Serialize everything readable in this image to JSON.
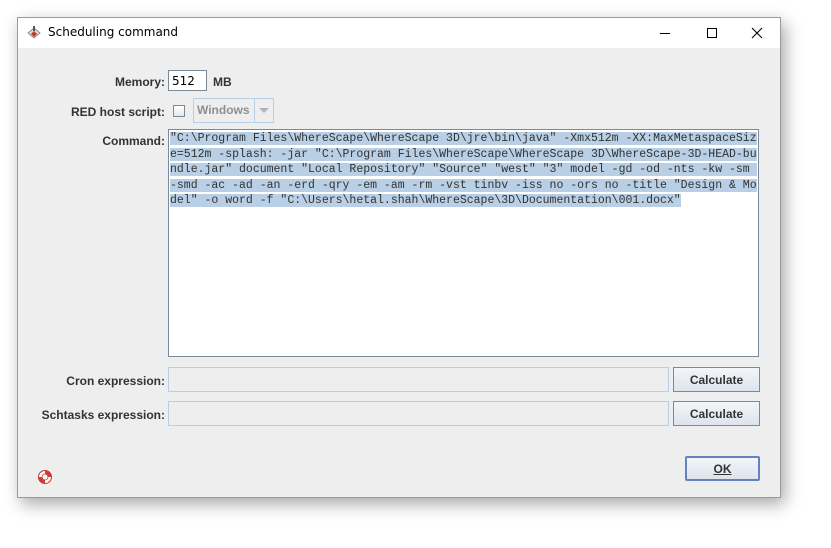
{
  "window": {
    "title": "Scheduling command"
  },
  "memory": {
    "label": "Memory:",
    "value": "512",
    "unit": "MB"
  },
  "red_host_script": {
    "label": "RED host script:",
    "checked": false,
    "os_value": "Windows"
  },
  "command": {
    "label": "Command:",
    "value": "\"C:\\Program Files\\WhereScape\\WhereScape 3D\\jre\\bin\\java\" -Xmx512m -XX:MaxMetaspaceSize=512m -splash: -jar \"C:\\Program Files\\WhereScape\\WhereScape 3D\\WhereScape-3D-HEAD-bundle.jar\" document \"Local Repository\" \"Source\" \"west\" \"3\" model -gd -od -nts -kw -sm -smd -ac -ad -an -erd -qry -em -am -rm -vst tinbv -iss no -ors no -title \"Design & Model\" -o word -f \"C:\\Users\\hetal.shah\\WhereScape\\3D\\Documentation\\001.docx\""
  },
  "cron": {
    "label": "Cron expression:",
    "value": "",
    "button_label": "Calculate"
  },
  "schtasks": {
    "label": "Schtasks expression:",
    "value": "",
    "button_label": "Calculate"
  },
  "ok_button": {
    "label": "OK"
  },
  "icons": {
    "app": "wherescape-app-icon",
    "help": "lifebuoy-help-icon",
    "minimize": "minimize-icon",
    "maximize": "maximize-icon",
    "close": "close-icon",
    "dropdown": "chevron-down-icon"
  },
  "colors": {
    "window_bg": "#eeeeee",
    "selection": "#b8cfe5",
    "field_border": "#7a8a99",
    "default_button_border": "#6382bf"
  }
}
